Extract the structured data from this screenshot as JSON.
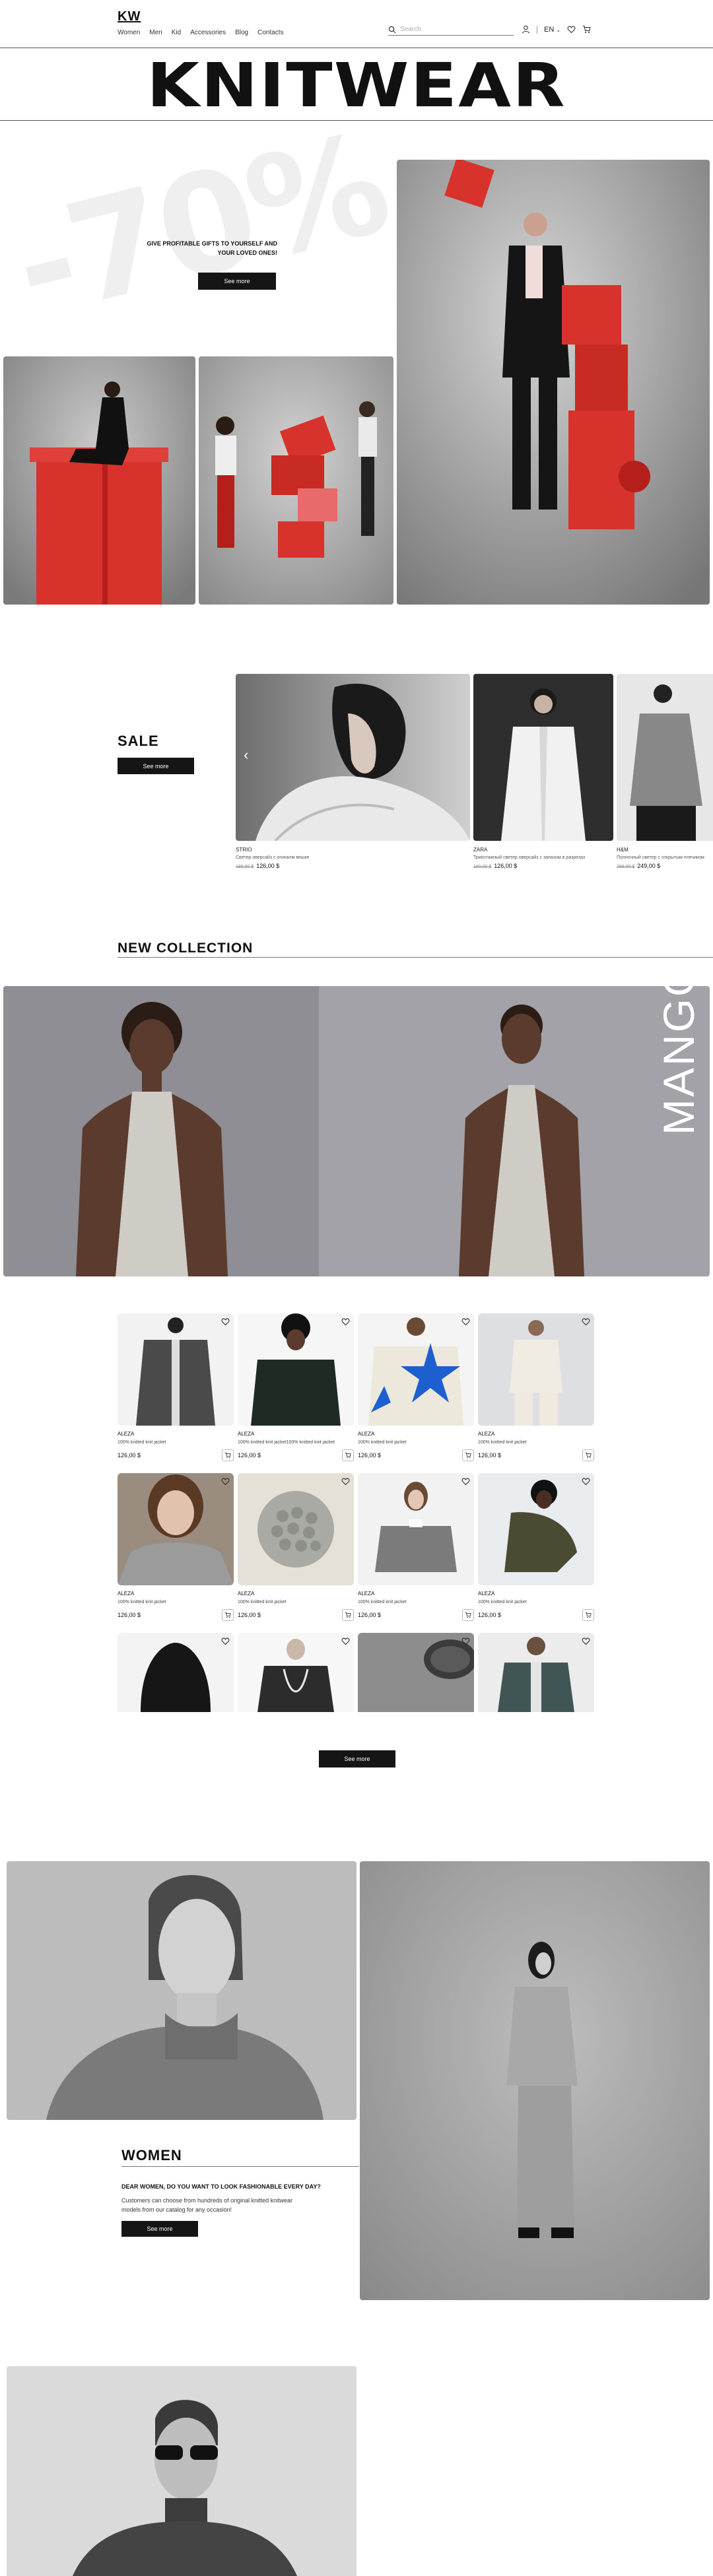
{
  "header": {
    "logo": "KW",
    "nav": [
      "Women",
      "Men",
      "Kid",
      "Accessories",
      "Blog",
      "Contacts"
    ],
    "search_placeholder": "Search",
    "lang": "EN"
  },
  "hero": {
    "title": "KNITWEAR"
  },
  "promo": {
    "discount": "-70%",
    "text": "GIVE PROFITABLE GIFTS TO YOURSELF AND YOUR LOVED ONES!",
    "button": "See more"
  },
  "sale": {
    "title": "SALE",
    "button": "See more",
    "cards": [
      {
        "brand": "STRIO",
        "desc": "Светер оверсайз с огиналм вешке",
        "old_price": "180,00 $",
        "price": "126,00 $"
      },
      {
        "brand": "ZARA",
        "desc": "Трикотажный светер оверсайз с запахом в разрезах",
        "old_price": "180,00 $",
        "price": "126,00 $"
      },
      {
        "brand": "H&M",
        "desc": "Полночный светер с открытым плечиком",
        "old_price": "289,00 $",
        "price": "249,00 $"
      }
    ]
  },
  "new_collection": {
    "title": "NEW COLLECTION",
    "brand_overlay": "MANGO"
  },
  "products": [
    {
      "brand": "ALEZA",
      "desc": "100% knitted knit jacket",
      "price": "126,00 $"
    },
    {
      "brand": "ALEZA",
      "desc": "100% knitted knit jacket100% knitted knit jacket",
      "price": "126,00 $"
    },
    {
      "brand": "ALEZA",
      "desc": "100% knitted knit jacket",
      "price": "126,00 $"
    },
    {
      "brand": "ALEZA",
      "desc": "100% knitted knit jacket",
      "price": "126,00 $"
    },
    {
      "brand": "ALEZA",
      "desc": "100% knitted knit jacket",
      "price": "126,00 $"
    },
    {
      "brand": "ALEZA",
      "desc": "100% knitted knit jacket",
      "price": "126,00 $"
    },
    {
      "brand": "ALEZA",
      "desc": "100% knitted knit jacket",
      "price": "126,00 $"
    },
    {
      "brand": "ALEZA",
      "desc": "100% knitted knit jacket",
      "price": "126,00 $"
    }
  ],
  "products_button": "See more",
  "women": {
    "title": "WOMEN",
    "question": "DEAR WOMEN, DO YOU WANT TO LOOK FASHIONABLE EVERY DAY?",
    "desc": "Customers can choose from hundreds of original knitted knitwear models from our catalog for any occasion!",
    "button": "See more"
  },
  "colors": {
    "accent_red": "#d8322c",
    "dark": "#151515"
  }
}
